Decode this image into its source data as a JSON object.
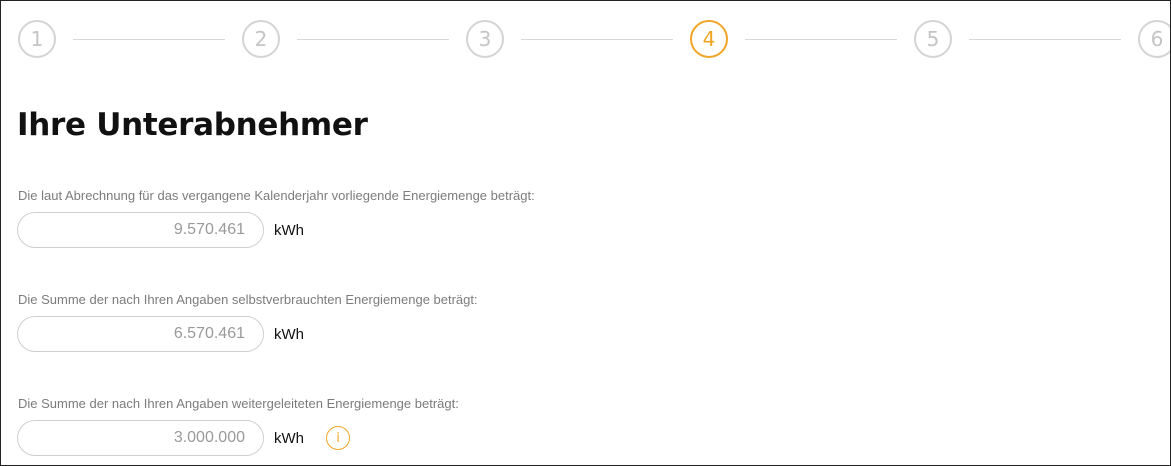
{
  "stepper": {
    "steps": [
      {
        "label": "1",
        "state": "inactive"
      },
      {
        "label": "2",
        "state": "inactive"
      },
      {
        "label": "3",
        "state": "inactive"
      },
      {
        "label": "4",
        "state": "active"
      },
      {
        "label": "5",
        "state": "inactive"
      },
      {
        "label": "6",
        "state": "inactive"
      }
    ],
    "colors": {
      "active": "#f0a526",
      "inactive": "#d4d4d4"
    }
  },
  "page": {
    "title": "Ihre Unterabnehmer"
  },
  "sections": [
    {
      "label": "Die laut Abrechnung für das vergangene Kalenderjahr vorliegende Energiemenge beträgt:",
      "value": "9.570.461",
      "unit": "kWh"
    },
    {
      "label": "Die Summe der nach Ihren Angaben selbstverbrauchten Energiemenge beträgt:",
      "value": "6.570.461",
      "unit": "kWh"
    },
    {
      "label": "Die Summe der nach Ihren Angaben weitergeleiteten Energiemenge beträgt:",
      "value": "3.000.000",
      "unit": "kWh",
      "info_icon": "info-icon",
      "info_glyph": "i"
    }
  ]
}
